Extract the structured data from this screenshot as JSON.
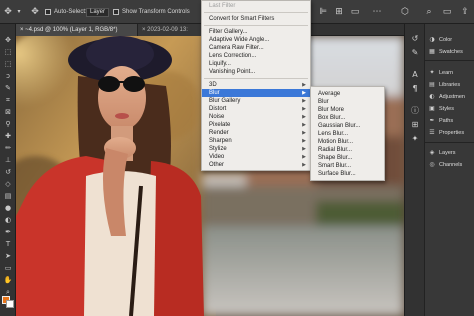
{
  "options_bar": {
    "auto_select_label": "Auto-Select:",
    "target_value": "Layer",
    "transform_label": "Show Transform Controls"
  },
  "tabs": [
    {
      "label": "~4.psd @ 100% (Layer 1, RGB/8*)"
    },
    {
      "label": "2023-02-09 13:"
    }
  ],
  "filter_menu": {
    "items": [
      {
        "label": "Last Filter",
        "disabled": true
      },
      {
        "label": "Convert for Smart Filters"
      },
      {
        "label": "Filter Gallery..."
      },
      {
        "label": "Adaptive Wide Angle..."
      },
      {
        "label": "Camera Raw Filter..."
      },
      {
        "label": "Lens Correction..."
      },
      {
        "label": "Liquify..."
      },
      {
        "label": "Vanishing Point..."
      },
      {
        "label": "3D"
      },
      {
        "label": "Blur",
        "highlighted": true
      },
      {
        "label": "Blur Gallery"
      },
      {
        "label": "Distort"
      },
      {
        "label": "Noise"
      },
      {
        "label": "Pixelate"
      },
      {
        "label": "Render"
      },
      {
        "label": "Sharpen"
      },
      {
        "label": "Stylize"
      },
      {
        "label": "Video"
      },
      {
        "label": "Other"
      }
    ]
  },
  "blur_submenu": {
    "items": [
      {
        "label": "Average"
      },
      {
        "label": "Blur"
      },
      {
        "label": "Blur More"
      },
      {
        "label": "Box Blur..."
      },
      {
        "label": "Gaussian Blur..."
      },
      {
        "label": "Lens Blur..."
      },
      {
        "label": "Motion Blur..."
      },
      {
        "label": "Radial Blur..."
      },
      {
        "label": "Shape Blur..."
      },
      {
        "label": "Smart Blur..."
      },
      {
        "label": "Surface Blur..."
      }
    ]
  },
  "right_panel": {
    "items": [
      {
        "label": "Color",
        "icon": "color-wheel-icon"
      },
      {
        "label": "Swatches",
        "icon": "swatches-icon"
      },
      {
        "label": "Learn",
        "icon": "lightbulb-icon"
      },
      {
        "label": "Libraries",
        "icon": "libraries-icon"
      },
      {
        "label": "Adjustmen",
        "icon": "adjustments-icon"
      },
      {
        "label": "Styles",
        "icon": "styles-icon"
      },
      {
        "label": "Paths",
        "icon": "paths-icon"
      },
      {
        "label": "Properties",
        "icon": "properties-icon"
      },
      {
        "label": "Layers",
        "icon": "layers-icon"
      },
      {
        "label": "Channels",
        "icon": "channels-icon"
      }
    ]
  },
  "colors": {
    "foreground": "#e8761b",
    "background": "#ffffff",
    "menu_highlight": "#3b78d8"
  }
}
